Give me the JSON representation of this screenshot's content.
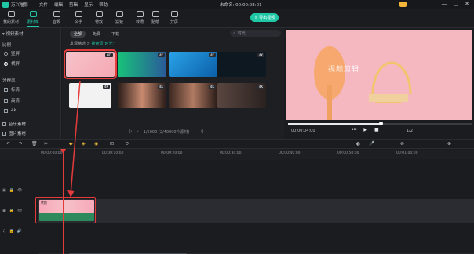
{
  "app": {
    "name": "万兴喵影",
    "menu": [
      "文件",
      "编辑",
      "剪辑",
      "显示",
      "帮助"
    ],
    "project_title": "未命名: 00:00:08:01",
    "controls": [
      "—",
      "▢",
      "✕"
    ]
  },
  "toolbar": {
    "tools": [
      {
        "label": "我的素材"
      },
      {
        "label": "素材库"
      },
      {
        "label": "音频"
      },
      {
        "label": "文字"
      },
      {
        "label": "特效"
      },
      {
        "label": "滤镜"
      },
      {
        "label": "转场"
      },
      {
        "label": "贴纸"
      },
      {
        "label": "分屏"
      }
    ],
    "active_tool": "素材库",
    "export_label": "导出视频"
  },
  "sidebar": {
    "section": "视频素材",
    "ratio_head": "比例",
    "ratios": [
      {
        "label": "竖屏"
      },
      {
        "label": "横屏"
      }
    ],
    "res_head": "分辨率",
    "resolutions": [
      {
        "label": "标清"
      },
      {
        "label": "高清"
      },
      {
        "label": "4k"
      }
    ],
    "extras": [
      {
        "label": "音乐素材"
      },
      {
        "label": "图片素材"
      }
    ]
  },
  "library": {
    "tabs": [
      "全部",
      "免费",
      "下载"
    ],
    "active_tab": "全部",
    "search_placeholder": "时光",
    "breadcrumb_prefix": "发现精选 >",
    "breadcrumb_query": "搜索词\"时光\"",
    "thumbs": [
      {
        "badge": "HD",
        "color": "#f4b5be"
      },
      {
        "badge": "4K",
        "color": "#2a8a6a"
      },
      {
        "badge": "4K",
        "color": "#1b7fcf"
      },
      {
        "badge": "4K",
        "color": "#0f1a24"
      },
      {
        "badge": "4K",
        "color": "#f0f0f0"
      },
      {
        "badge": "4K",
        "color": "#7a4b3c"
      },
      {
        "badge": "4K",
        "color": "#8a5a48"
      },
      {
        "badge": "4K",
        "color": "#4a3a34"
      }
    ],
    "pager": "1/5000 (2/40000个素材)"
  },
  "preview": {
    "watermark": "视频剪辑",
    "time": "00:00:04:00",
    "ratio": "1/2",
    "progress": 0.5
  },
  "ruler": [
    "00:00:00:00",
    "00:00:10:00",
    "00:00:20:00",
    "00:00:30:00",
    "00:00:40:00",
    "00:00:50:00",
    "00:01:00:00"
  ],
  "clip": {
    "label": "转换"
  }
}
